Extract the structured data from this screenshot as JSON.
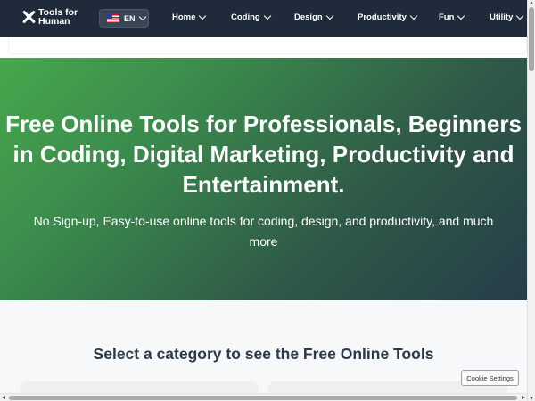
{
  "logo": {
    "line1": "Tools for",
    "line2": "Human"
  },
  "language": {
    "code": "EN",
    "flag": "us-flag-icon"
  },
  "nav": {
    "home": "Home",
    "coding": "Coding",
    "design": "Design",
    "productivity": "Productivity",
    "fun": "Fun",
    "utility": "Utility"
  },
  "hero": {
    "title": "Free Online Tools for Professionals, Beginners in Coding, Digital Marketing, Productivity and Entertainment.",
    "subtitle": "No Sign-up, Easy-to-use online tools for coding, design, and productivity, and much more"
  },
  "category": {
    "heading": "Select a category to see the Free Online Tools"
  },
  "cookie": {
    "label": "Cookie Settings"
  },
  "colors": {
    "navbar": "#1f2b3a",
    "hero_start": "#46a84c",
    "hero_end": "#273d4a",
    "heading": "#2d3a4b"
  }
}
